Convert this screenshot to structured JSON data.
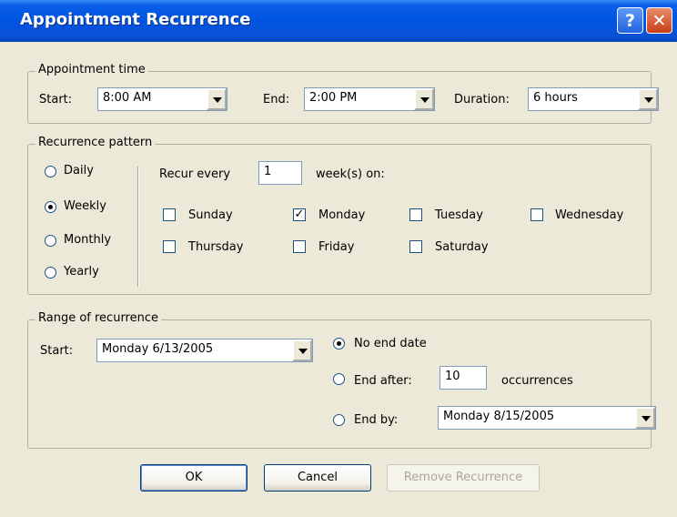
{
  "window": {
    "title": "Appointment Recurrence",
    "help_glyph": "?",
    "close_glyph": "✕"
  },
  "appointment_time": {
    "legend": "Appointment time",
    "start_label": "Start:",
    "start_value": "8:00 AM",
    "end_label": "End:",
    "end_value": "2:00 PM",
    "duration_label": "Duration:",
    "duration_value": "6 hours"
  },
  "recurrence_pattern": {
    "legend": "Recurrence pattern",
    "frequency_options": [
      "Daily",
      "Weekly",
      "Monthly",
      "Yearly"
    ],
    "selected_frequency": "Weekly",
    "recur_every_label": "Recur every",
    "recur_every_value": "1",
    "weeks_on_label": "week(s) on:",
    "days": [
      "Sunday",
      "Monday",
      "Tuesday",
      "Wednesday",
      "Thursday",
      "Friday",
      "Saturday"
    ],
    "checked_days": [
      "Monday"
    ]
  },
  "range": {
    "legend": "Range of recurrence",
    "start_label": "Start:",
    "start_value": "Monday 6/13/2005",
    "no_end_label": "No end date",
    "end_after_label": "End after:",
    "end_after_value": "10",
    "occurrences_label": "occurrences",
    "end_by_label": "End by:",
    "end_by_value": "Monday 8/15/2005",
    "selected_end": "No end date"
  },
  "buttons": {
    "ok": "OK",
    "cancel": "Cancel",
    "remove": "Remove Recurrence"
  }
}
